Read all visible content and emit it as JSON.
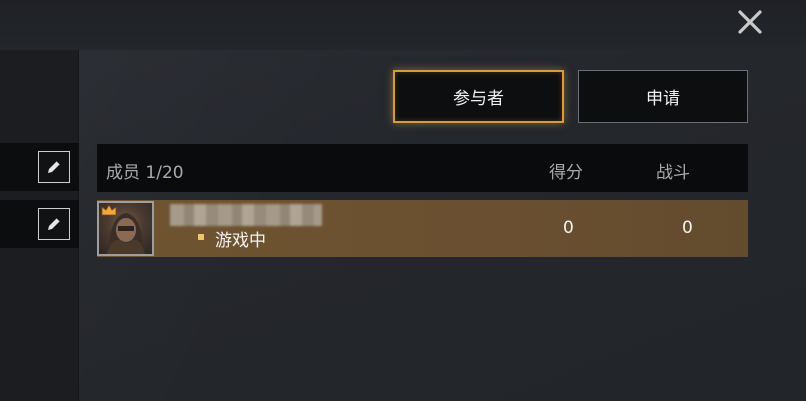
{
  "tabs": {
    "participants": "参与者",
    "apply": "申请"
  },
  "table": {
    "headers": {
      "members": "成员 1/20",
      "score": "得分",
      "battle": "战斗"
    },
    "rows": [
      {
        "status": "游戏中",
        "score": "0",
        "battle": "0"
      }
    ]
  },
  "colors": {
    "accent": "#d89a3c",
    "row_highlight": "#6f5430",
    "status_dot": "#f0c46a"
  },
  "icons": [
    "close-icon",
    "pencil-icon",
    "crown-icon"
  ]
}
